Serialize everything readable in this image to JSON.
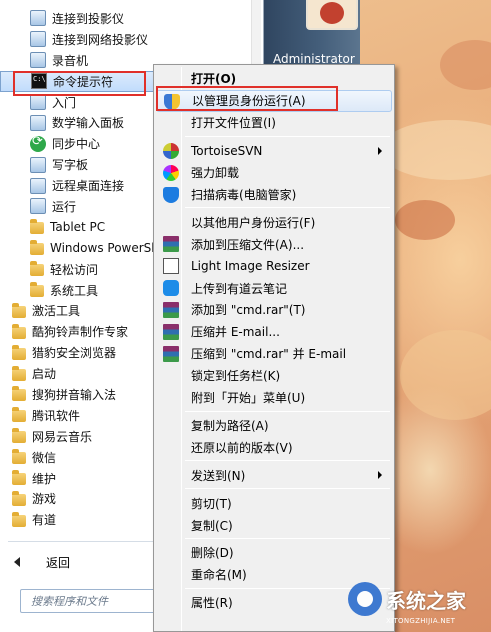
{
  "user": {
    "name": "Administrator"
  },
  "programs": [
    {
      "label": "连接到投影仪",
      "icon": "projector-icon",
      "indent": 1
    },
    {
      "label": "连接到网络投影仪",
      "icon": "network-projector-icon",
      "indent": 1
    },
    {
      "label": "录音机",
      "icon": "microphone-icon",
      "indent": 1
    },
    {
      "label": "命令提示符",
      "icon": "cmd-icon",
      "indent": 1,
      "selected": true
    },
    {
      "label": "入门",
      "icon": "getting-started-icon",
      "indent": 1
    },
    {
      "label": "数学输入面板",
      "icon": "math-input-icon",
      "indent": 1
    },
    {
      "label": "同步中心",
      "icon": "sync-center-icon",
      "indent": 1
    },
    {
      "label": "写字板",
      "icon": "wordpad-icon",
      "indent": 1
    },
    {
      "label": "远程桌面连接",
      "icon": "remote-desktop-icon",
      "indent": 1
    },
    {
      "label": "运行",
      "icon": "run-icon",
      "indent": 1
    },
    {
      "label": "Tablet PC",
      "icon": "folder-icon",
      "indent": 1
    },
    {
      "label": "Windows PowerSh",
      "icon": "folder-icon",
      "indent": 1
    },
    {
      "label": "轻松访问",
      "icon": "folder-icon",
      "indent": 1
    },
    {
      "label": "系统工具",
      "icon": "folder-icon",
      "indent": 1
    },
    {
      "label": "激活工具",
      "icon": "folder-icon",
      "indent": 0
    },
    {
      "label": "酷狗铃声制作专家",
      "icon": "folder-icon",
      "indent": 0
    },
    {
      "label": "猎豹安全浏览器",
      "icon": "folder-icon",
      "indent": 0
    },
    {
      "label": "启动",
      "icon": "folder-icon",
      "indent": 0
    },
    {
      "label": "搜狗拼音输入法",
      "icon": "folder-icon",
      "indent": 0
    },
    {
      "label": "腾讯软件",
      "icon": "folder-icon",
      "indent": 0
    },
    {
      "label": "网易云音乐",
      "icon": "folder-icon",
      "indent": 0
    },
    {
      "label": "微信",
      "icon": "folder-icon",
      "indent": 0
    },
    {
      "label": "维护",
      "icon": "folder-icon",
      "indent": 0
    },
    {
      "label": "游戏",
      "icon": "folder-icon",
      "indent": 0
    },
    {
      "label": "有道",
      "icon": "folder-icon",
      "indent": 0
    }
  ],
  "back_label": "返回",
  "search": {
    "placeholder": "搜索程序和文件"
  },
  "context_menu": {
    "items": [
      {
        "label": "打开(O)",
        "bold": true
      },
      {
        "label": "以管理员身份运行(A)",
        "icon": "uac-shield-icon",
        "highlighted": true
      },
      {
        "label": "打开文件位置(I)"
      },
      {
        "separator": true
      },
      {
        "label": "TortoiseSVN",
        "icon": "tortoisesvn-icon",
        "submenu": true
      },
      {
        "label": "强力卸载",
        "icon": "uninstall-icon"
      },
      {
        "label": "扫描病毒(电脑管家)",
        "icon": "antivirus-icon"
      },
      {
        "separator": true
      },
      {
        "label": "以其他用户身份运行(F)"
      },
      {
        "label": "添加到压缩文件(A)...",
        "icon": "winrar-icon"
      },
      {
        "label": "Light Image Resizer",
        "icon": "image-resizer-icon"
      },
      {
        "label": "上传到有道云笔记",
        "icon": "youdao-cloud-icon"
      },
      {
        "label": "添加到 \"cmd.rar\"(T)",
        "icon": "winrar-icon"
      },
      {
        "label": "压缩并 E-mail...",
        "icon": "winrar-icon"
      },
      {
        "label": "压缩到 \"cmd.rar\" 并 E-mail",
        "icon": "winrar-icon"
      },
      {
        "label": "锁定到任务栏(K)"
      },
      {
        "label": "附到「开始」菜单(U)"
      },
      {
        "separator": true
      },
      {
        "label": "复制为路径(A)"
      },
      {
        "label": "还原以前的版本(V)"
      },
      {
        "separator": true
      },
      {
        "label": "发送到(N)",
        "submenu": true
      },
      {
        "separator": true
      },
      {
        "label": "剪切(T)"
      },
      {
        "label": "复制(C)"
      },
      {
        "separator": true
      },
      {
        "label": "删除(D)"
      },
      {
        "label": "重命名(M)"
      },
      {
        "separator": true
      },
      {
        "label": "属性(R)"
      }
    ]
  },
  "watermark": {
    "text": "系统之家",
    "url": "XITONGZHIJIA.NET"
  },
  "colors": {
    "highlight_box": "#e0302a",
    "start_pane": "#ffffff",
    "menu_bg": "#f0f0f0"
  }
}
